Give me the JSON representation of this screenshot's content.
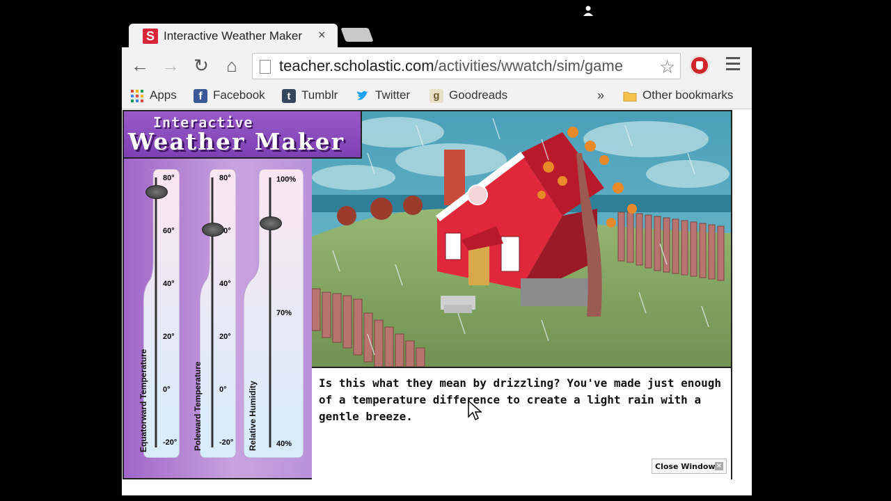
{
  "browser": {
    "tab_title": "Interactive Weather Maker",
    "tab_favicon_letter": "S",
    "tab_close": "×",
    "url_host": "teacher.scholastic.com",
    "url_path": "/activities/wwatch/sim/game",
    "back": "←",
    "forward": "→",
    "reload": "↻",
    "home": "⌂",
    "star": "☆",
    "bookmarks": [
      {
        "label": "Apps",
        "icon": "apps-grid-icon",
        "color": "#e34a3b"
      },
      {
        "label": "Facebook",
        "icon": "facebook-icon",
        "color": "#3b5998"
      },
      {
        "label": "Tumblr",
        "icon": "tumblr-icon",
        "color": "#36465d"
      },
      {
        "label": "Twitter",
        "icon": "twitter-icon",
        "color": "#1da1f2"
      },
      {
        "label": "Goodreads",
        "icon": "goodreads-icon",
        "color": "#b9a46e"
      }
    ],
    "more_bookmarks": "»",
    "other_bookmarks": "Other bookmarks"
  },
  "app": {
    "title_top": "Interactive",
    "title_main": "Weather Maker",
    "sliders": [
      {
        "label": "Equatorward Temperature",
        "ticks": [
          "80°",
          "60°",
          "40°",
          "20°",
          "0°",
          "-20°"
        ],
        "value": 75,
        "min": -20,
        "max": 80,
        "unit": "°"
      },
      {
        "label": "Poleward Temperature",
        "ticks": [
          "80°",
          "60°",
          "40°",
          "20°",
          "0°",
          "-20°"
        ],
        "value": 61,
        "min": -20,
        "max": 80,
        "unit": "°"
      },
      {
        "label": "Relative Humidity",
        "ticks": [
          "100%",
          "70%",
          "40%"
        ],
        "value": 90,
        "min": 40,
        "max": 100,
        "unit": "%"
      }
    ],
    "message": "Is this what they mean by drizzling? You've made just enough of a temperature difference to create a light rain with a gentle breeze.",
    "close_window": "Close Window",
    "close_x": "×"
  },
  "colors": {
    "slider_top": "#fbe6ef",
    "slider_bottom": "#d6ecfb",
    "sky": "#5fb4c9",
    "grass": "#8ab06a",
    "house": "#e0283a"
  }
}
